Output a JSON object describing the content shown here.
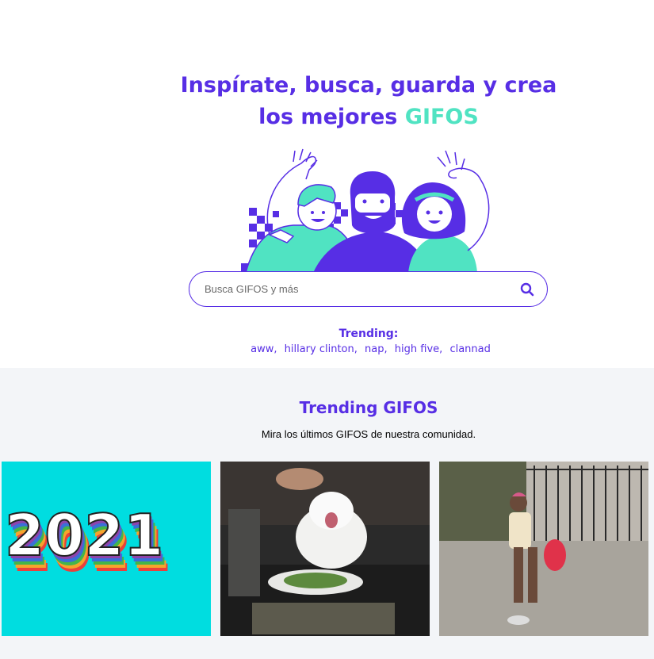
{
  "hero": {
    "title_line1": "Inspírate, busca, guarda y crea",
    "title_line2_prefix": "los mejores ",
    "title_line2_accent": "GIFOS"
  },
  "search": {
    "placeholder": "Busca GIFOS y más",
    "icon": "search-icon"
  },
  "trending": {
    "label": "Trending:",
    "terms": [
      "aww",
      "hillary clinton",
      "nap",
      "high five",
      "clannad"
    ],
    "separator": ","
  },
  "gifos_section": {
    "title": "Trending GIFOS",
    "subtitle": "Mira los últimos GIFOS de nuestra comunidad.",
    "gifs": [
      {
        "caption": "2021"
      },
      {},
      {}
    ]
  },
  "colors": {
    "primary": "#572ee5",
    "accent": "#50e3c2",
    "section_bg": "#f3f5f8",
    "gif1_bg": "#00dde0"
  }
}
